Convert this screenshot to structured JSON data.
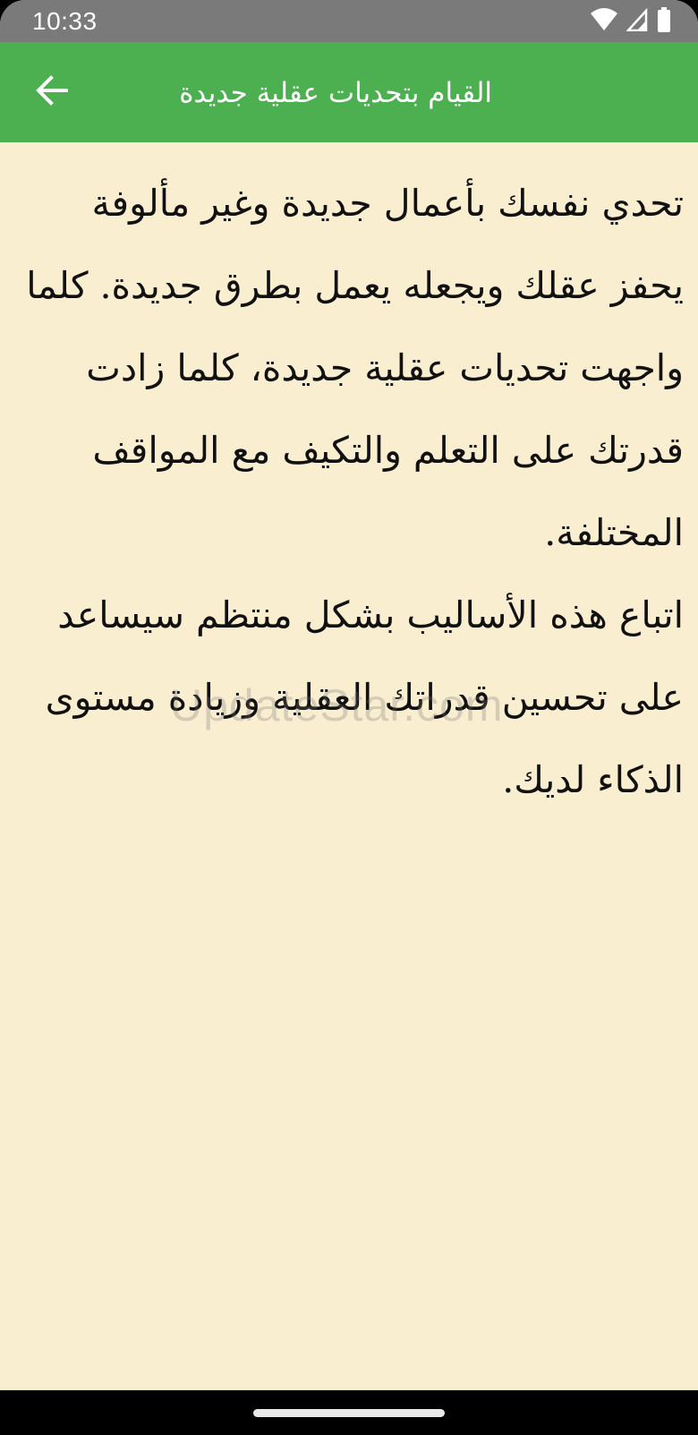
{
  "status_bar": {
    "time": "10:33",
    "icons": [
      "wifi-icon",
      "signal-icon",
      "battery-icon"
    ]
  },
  "app_bar": {
    "title": "القيام بتحديات عقلية جديدة",
    "back_icon": "arrow-left-icon",
    "color": "#4caf50"
  },
  "content": {
    "text": "تحدي نفسك بأعمال جديدة وغير مألوفة يحفز عقلك ويجعله يعمل بطرق جديدة. كلما واجهت تحديات عقلية جديدة، كلما زادت قدرتك على التعلم والتكيف مع المواقف المختلفة.\nاتباع هذه الأساليب بشكل منتظم سيساعد على تحسين قدراتك العقلية وزيادة مستوى الذكاء لديك.",
    "background": "#faeed1"
  },
  "watermark": {
    "text": "UpdateStar.com"
  }
}
